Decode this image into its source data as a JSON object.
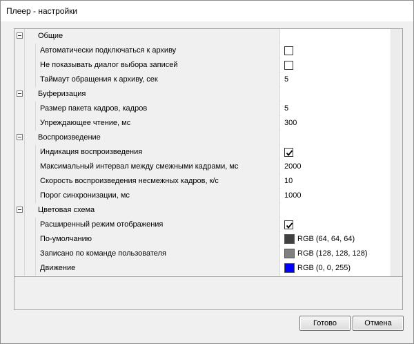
{
  "window": {
    "title": "Плеер - настройки"
  },
  "grid": {
    "categories": [
      {
        "label": "Общие",
        "props": [
          {
            "name": "Автоматически подключаться к архиву",
            "type": "checkbox",
            "checked": false
          },
          {
            "name": "Не показывать диалог выбора записей",
            "type": "checkbox",
            "checked": false
          },
          {
            "name": "Таймаут обращения к архиву, сек",
            "type": "text",
            "value": "5"
          }
        ]
      },
      {
        "label": "Буферизация",
        "props": [
          {
            "name": "Размер пакета кадров, кадров",
            "type": "text",
            "value": "5"
          },
          {
            "name": "Упреждающее чтение, мс",
            "type": "text",
            "value": "300"
          }
        ]
      },
      {
        "label": "Воспроизведение",
        "props": [
          {
            "name": "Индикация воспроизведения",
            "type": "checkbox",
            "checked": true
          },
          {
            "name": "Максимальный интервал между смежными кадрами, мс",
            "type": "text",
            "value": "2000"
          },
          {
            "name": "Скорость воспроизведения несмежных кадров, к/с",
            "type": "text",
            "value": "10"
          },
          {
            "name": "Порог синхронизации, мс",
            "type": "text",
            "value": "1000"
          }
        ]
      },
      {
        "label": "Цветовая схема",
        "props": [
          {
            "name": "Расширенный режим отображения",
            "type": "checkbox",
            "checked": true
          },
          {
            "name": "По-умолчанию",
            "type": "color",
            "value": "RGB (64, 64, 64)",
            "color": "#404040"
          },
          {
            "name": "Записано по команде пользователя",
            "type": "color",
            "value": "RGB (128, 128, 128)",
            "color": "#808080"
          },
          {
            "name": "Движение",
            "type": "color",
            "value": "RGB (0, 0, 255)",
            "color": "#0000ff"
          }
        ]
      }
    ]
  },
  "buttons": {
    "ok": "Готово",
    "cancel": "Отмена"
  }
}
